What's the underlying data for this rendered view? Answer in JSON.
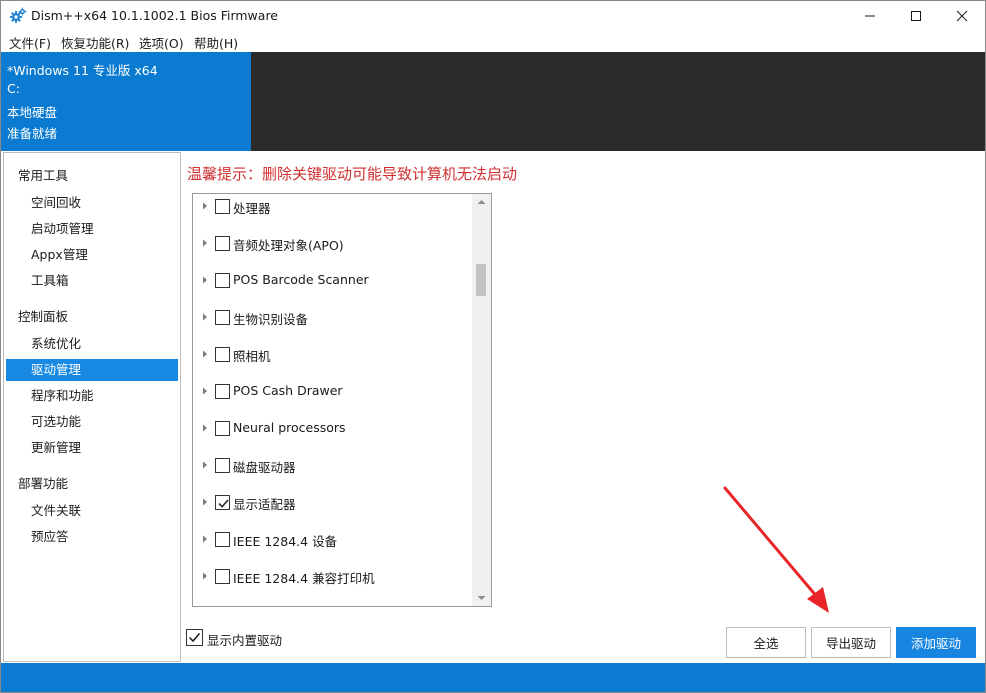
{
  "window": {
    "title": "Dism++x64 10.1.1002.1 Bios Firmware",
    "icon": "gear-icon",
    "controls": [
      "minimize-icon",
      "maximize-icon",
      "close-icon"
    ]
  },
  "menu": [
    "文件(F)",
    "恢复功能(R)",
    "选项(O)",
    "帮助(H)"
  ],
  "header": {
    "lines": [
      "*Windows 11 专业版 x64",
      "C:",
      "本地硬盘",
      "准备就绪"
    ]
  },
  "sidebar": {
    "groups": [
      {
        "title": "常用工具",
        "items": [
          "空间回收",
          "启动项管理",
          "Appx管理",
          "工具箱"
        ]
      },
      {
        "title": "控制面板",
        "items": [
          "系统优化",
          "驱动管理",
          "程序和功能",
          "可选功能",
          "更新管理"
        ]
      },
      {
        "title": "部署功能",
        "items": [
          "文件关联",
          "预应答"
        ]
      }
    ],
    "active": "驱动管理"
  },
  "main": {
    "warning": "温馨提示：删除关键驱动可能导致计算机无法启动",
    "tree": [
      {
        "label": "处理器",
        "checked": false
      },
      {
        "label": "音频处理对象(APO)",
        "checked": false
      },
      {
        "label": "POS Barcode Scanner",
        "checked": false
      },
      {
        "label": "生物识别设备",
        "checked": false
      },
      {
        "label": "照相机",
        "checked": false
      },
      {
        "label": "POS Cash Drawer",
        "checked": false
      },
      {
        "label": "Neural processors",
        "checked": false
      },
      {
        "label": "磁盘驱动器",
        "checked": false
      },
      {
        "label": "显示适配器",
        "checked": true
      },
      {
        "label": "IEEE 1284.4 设备",
        "checked": false
      },
      {
        "label": "IEEE 1284.4 兼容打印机",
        "checked": false
      }
    ],
    "show_builtin": {
      "label": "显示内置驱动",
      "checked": true
    },
    "buttons": {
      "select_all": "全选",
      "export": "导出驱动",
      "add": "添加驱动"
    }
  },
  "colors": {
    "accent": "#0a7bd0",
    "header_dark": "#2b2b2b",
    "warning": "#d03030",
    "selected": "#1889e3",
    "annotation": "#e8262a"
  }
}
